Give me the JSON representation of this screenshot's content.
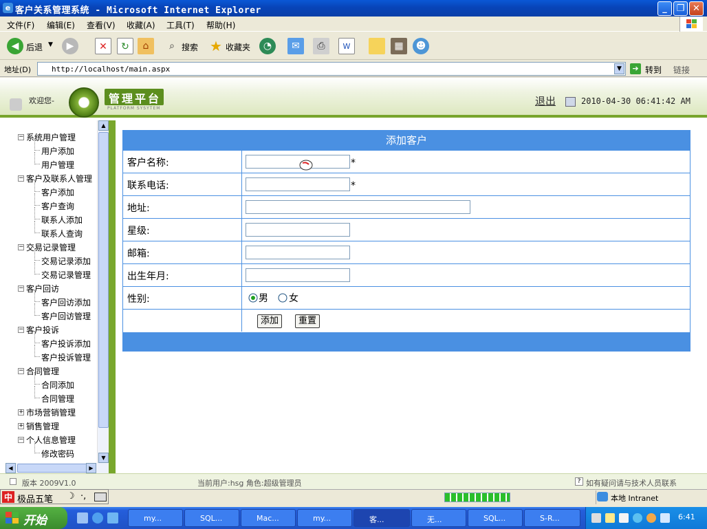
{
  "window": {
    "title": "客户关系管理系统 - Microsoft Internet Explorer",
    "minimize": "_",
    "maximize": "❐",
    "close": "✕"
  },
  "menu": [
    "文件(F)",
    "编辑(E)",
    "查看(V)",
    "收藏(A)",
    "工具(T)",
    "帮助(H)"
  ],
  "toolbar": {
    "back": "后退",
    "search": "搜索",
    "favorites": "收藏夹"
  },
  "address": {
    "label": "地址(D)",
    "url": "http://localhost/main.aspx",
    "go": "转到",
    "links": "链接"
  },
  "header": {
    "welcome": "欢迎您-",
    "logo_text": "管理平台",
    "logo_sub": "PLATFORM SYSYTEM",
    "logout": "退出",
    "datetime": "2010-04-30 06:41:42 AM"
  },
  "nav": [
    {
      "label": "系统用户管理",
      "children": [
        "用户添加",
        "用户管理"
      ]
    },
    {
      "label": "客户及联系人管理",
      "children": [
        "客户添加",
        "客户查询",
        "联系人添加",
        "联系人查询"
      ]
    },
    {
      "label": "交易记录管理",
      "children": [
        "交易记录添加",
        "交易记录管理"
      ]
    },
    {
      "label": "客户回访",
      "children": [
        "客户回访添加",
        "客户回访管理"
      ]
    },
    {
      "label": "客户投诉",
      "children": [
        "客户投诉添加",
        "客户投诉管理"
      ]
    },
    {
      "label": "合同管理",
      "children": [
        "合同添加",
        "合同管理"
      ]
    },
    {
      "label": "市场营销管理",
      "children": []
    },
    {
      "label": "销售管理",
      "children": []
    },
    {
      "label": "个人信息管理",
      "children": [
        "修改密码"
      ]
    }
  ],
  "form": {
    "title": "添加客户",
    "fields": [
      {
        "label": "客户名称:",
        "value": "",
        "required": "*"
      },
      {
        "label": "联系电话:",
        "value": "",
        "required": "*"
      },
      {
        "label": "地址:",
        "value": ""
      },
      {
        "label": "星级:",
        "value": ""
      },
      {
        "label": "邮箱:",
        "value": ""
      },
      {
        "label": "出生年月:",
        "value": ""
      }
    ],
    "gender": {
      "label": "性别:",
      "male": "男",
      "female": "女",
      "selected": "男"
    },
    "add_button": "添加",
    "reset_button": "重置"
  },
  "footer": {
    "version": "版本 2009V1.0",
    "current_user": "当前用户:hsg 角色:超级管理员",
    "contact": "如有疑问请与技术人员联系"
  },
  "ime": {
    "name": "极品五笔",
    "moon": "☽",
    "punct": "·,"
  },
  "ie_status": {
    "zone": "本地 Intranet",
    "progress": 1.0
  },
  "taskbar": {
    "start": "开始",
    "tasks": [
      "my...",
      "SQL...",
      "Mac...",
      "my...",
      "客...",
      "无...",
      "SQL...",
      "S-R..."
    ],
    "active_task": "客...",
    "clock": "6:41"
  },
  "colors": {
    "accent_blue": "#4a90e2",
    "header_green": "#79a72d"
  }
}
